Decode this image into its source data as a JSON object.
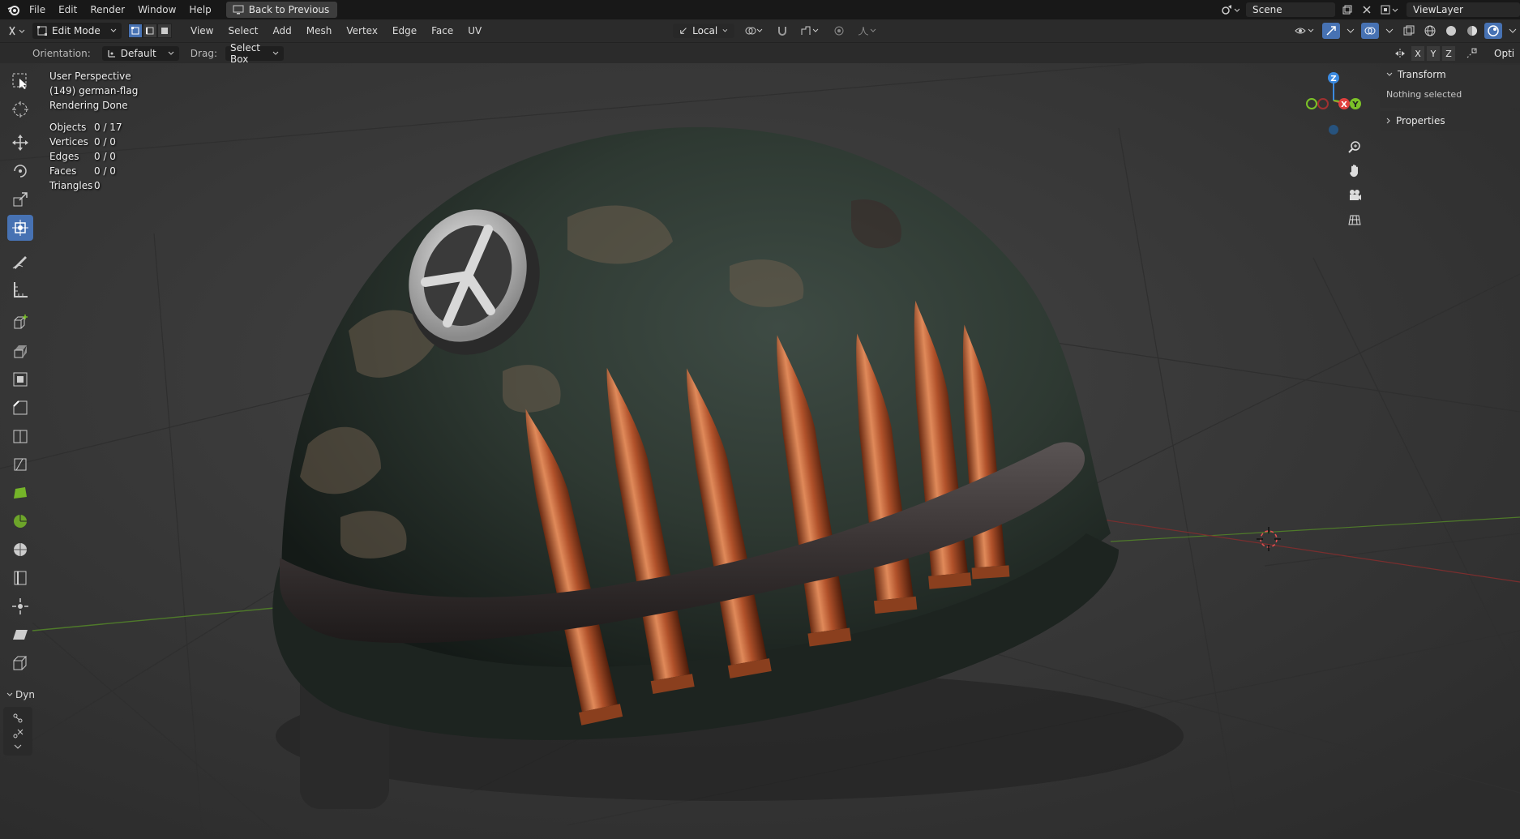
{
  "topbar": {
    "menus": [
      "File",
      "Edit",
      "Render",
      "Window",
      "Help"
    ],
    "back_button": "Back to Previous",
    "scene": "Scene",
    "view_layer": "ViewLayer"
  },
  "header": {
    "mode": "Edit Mode",
    "menus": [
      "View",
      "Select",
      "Add",
      "Mesh",
      "Vertex",
      "Edge",
      "Face",
      "UV"
    ],
    "transform_orientation": "Local"
  },
  "tool_settings": {
    "orientation_label": "Orientation:",
    "orientation_value": "Default",
    "drag_label": "Drag:",
    "drag_value": "Select Box",
    "axes": [
      "X",
      "Y",
      "Z"
    ],
    "options_label": "Opti"
  },
  "viewport": {
    "view_name": "User Perspective",
    "object_name": "(149) german-flag",
    "status": "Rendering Done",
    "stats": [
      {
        "key": "Objects",
        "value": "0 / 17"
      },
      {
        "key": "Vertices",
        "value": "0 / 0"
      },
      {
        "key": "Edges",
        "value": "0 / 0"
      },
      {
        "key": "Faces",
        "value": "0 / 0"
      },
      {
        "key": "Triangles",
        "value": "0"
      }
    ]
  },
  "gizmo": {
    "x": "X",
    "y": "Y",
    "z": "Z"
  },
  "sidebar_panel": {
    "transform_title": "Transform",
    "transform_body": "Nothing selected",
    "properties_title": "Properties"
  },
  "toolbar": {
    "dynamic_label": "Dyn"
  },
  "colors": {
    "accent": "#4772b3",
    "x_axis": "#e0403e",
    "y_axis": "#7cc228",
    "z_axis": "#3b8ae0"
  }
}
